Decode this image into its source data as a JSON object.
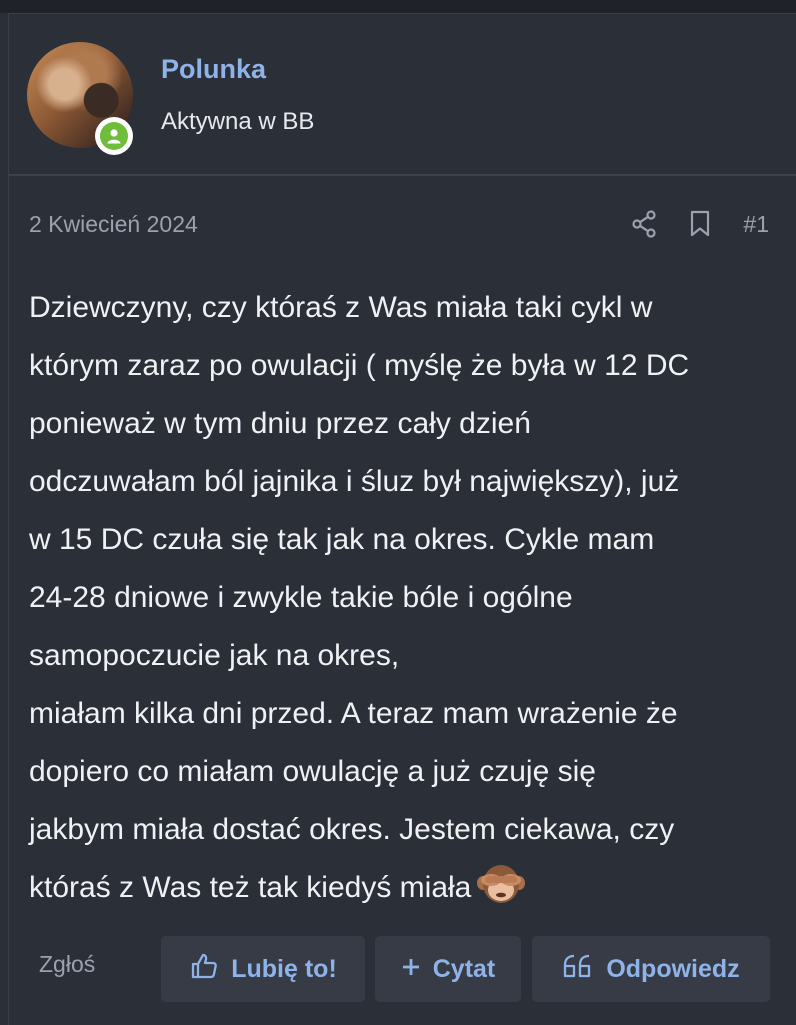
{
  "author": {
    "name": "Polunka",
    "role": "Aktywna w BB",
    "online_color": "#6fbd3b"
  },
  "post": {
    "date": "2 Kwiecień 2024",
    "number": "#1",
    "icons": [
      "share-icon",
      "bookmark-icon"
    ],
    "text": "Dziewczyny, czy któraś z Was miała taki cykl w\nktórym zaraz po owulacji ( myślę że była w 12 DC\nponieważ w tym dniu przez cały dzień\nodczuwałam ból jajnika i śluz był największy), już\nw 15 DC czuła się tak jak na okres. Cykle mam\n24-28 dniowe i zwykle takie bóle i ogólne\nsamopoczucie jak na okres,\nmiałam kilka dni przed. A teraz mam wrażenie że\ndopiero co miałam owulację a już czuję się\njakbym miała dostać okres. Jestem ciekawa, czy\nktóraś z Was też tak kiedyś miała",
    "emoji": "see-no-evil-monkey"
  },
  "actions": {
    "report": "Zgłoś",
    "like": "Lubię to!",
    "quote": "Cytat",
    "reply": "Odpowiedz"
  },
  "colors": {
    "background": "#2b2f38",
    "accent": "#8fb3e8",
    "muted": "#9ba1ad",
    "button_bg": "#363b46"
  }
}
